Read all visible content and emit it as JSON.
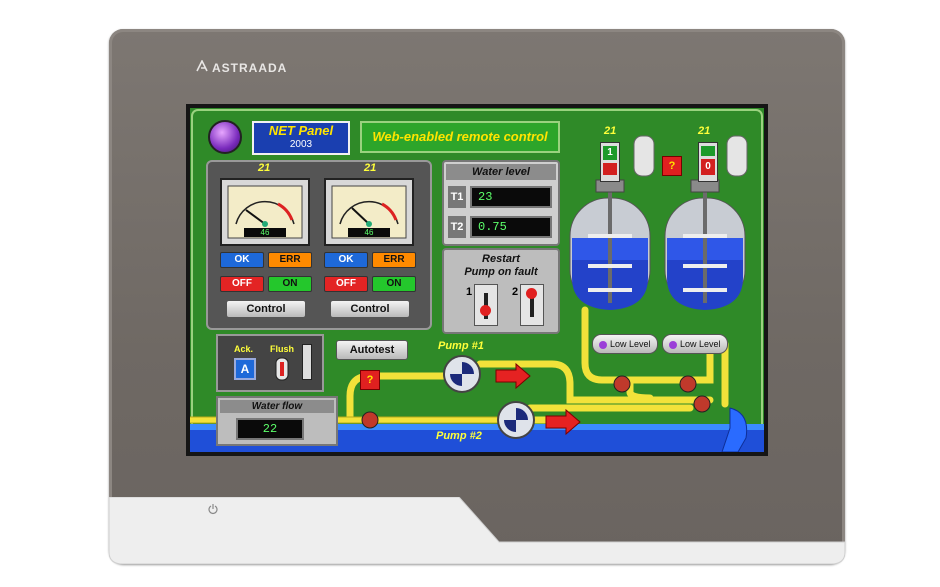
{
  "brand": {
    "name": "ASTRAADA"
  },
  "hmi": {
    "logo": {
      "title": "NET Panel",
      "year": "2003"
    },
    "banner": "Web-enabled remote control",
    "gauges": [
      {
        "top_label": "21",
        "reading": "46",
        "ok": "OK",
        "err": "ERR",
        "off": "OFF",
        "on": "ON",
        "control": "Control"
      },
      {
        "top_label": "21",
        "reading": "46",
        "ok": "OK",
        "err": "ERR",
        "off": "OFF",
        "on": "ON",
        "control": "Control"
      }
    ],
    "water_level": {
      "title": "Water level",
      "t1_label": "T1",
      "t1_value": "23",
      "t2_label": "T2",
      "t2_value": "0.75"
    },
    "restart": {
      "title_line1": "Restart",
      "title_line2": "Pump on fault",
      "switch1": "1",
      "switch2": "2"
    },
    "tanks": [
      {
        "top_label": "21",
        "indicator": "1",
        "level_button": "Low Level"
      },
      {
        "top_label": "21",
        "indicator": "0",
        "level_button": "Low Level"
      }
    ],
    "help_symbol": "?",
    "ack": {
      "ack_label": "Ack.",
      "flush_label": "Flush",
      "ack_button": "A"
    },
    "autotest": "Autotest",
    "water_flow": {
      "title": "Water flow",
      "value": "22"
    },
    "pump1": "Pump #1",
    "pump2": "Pump #2",
    "colors": {
      "screen_green": "#2f8a28",
      "pipe_yellow": "#f2e23a",
      "water_blue": "#1f4fd8",
      "lcd_green": "#5cff6a"
    }
  }
}
